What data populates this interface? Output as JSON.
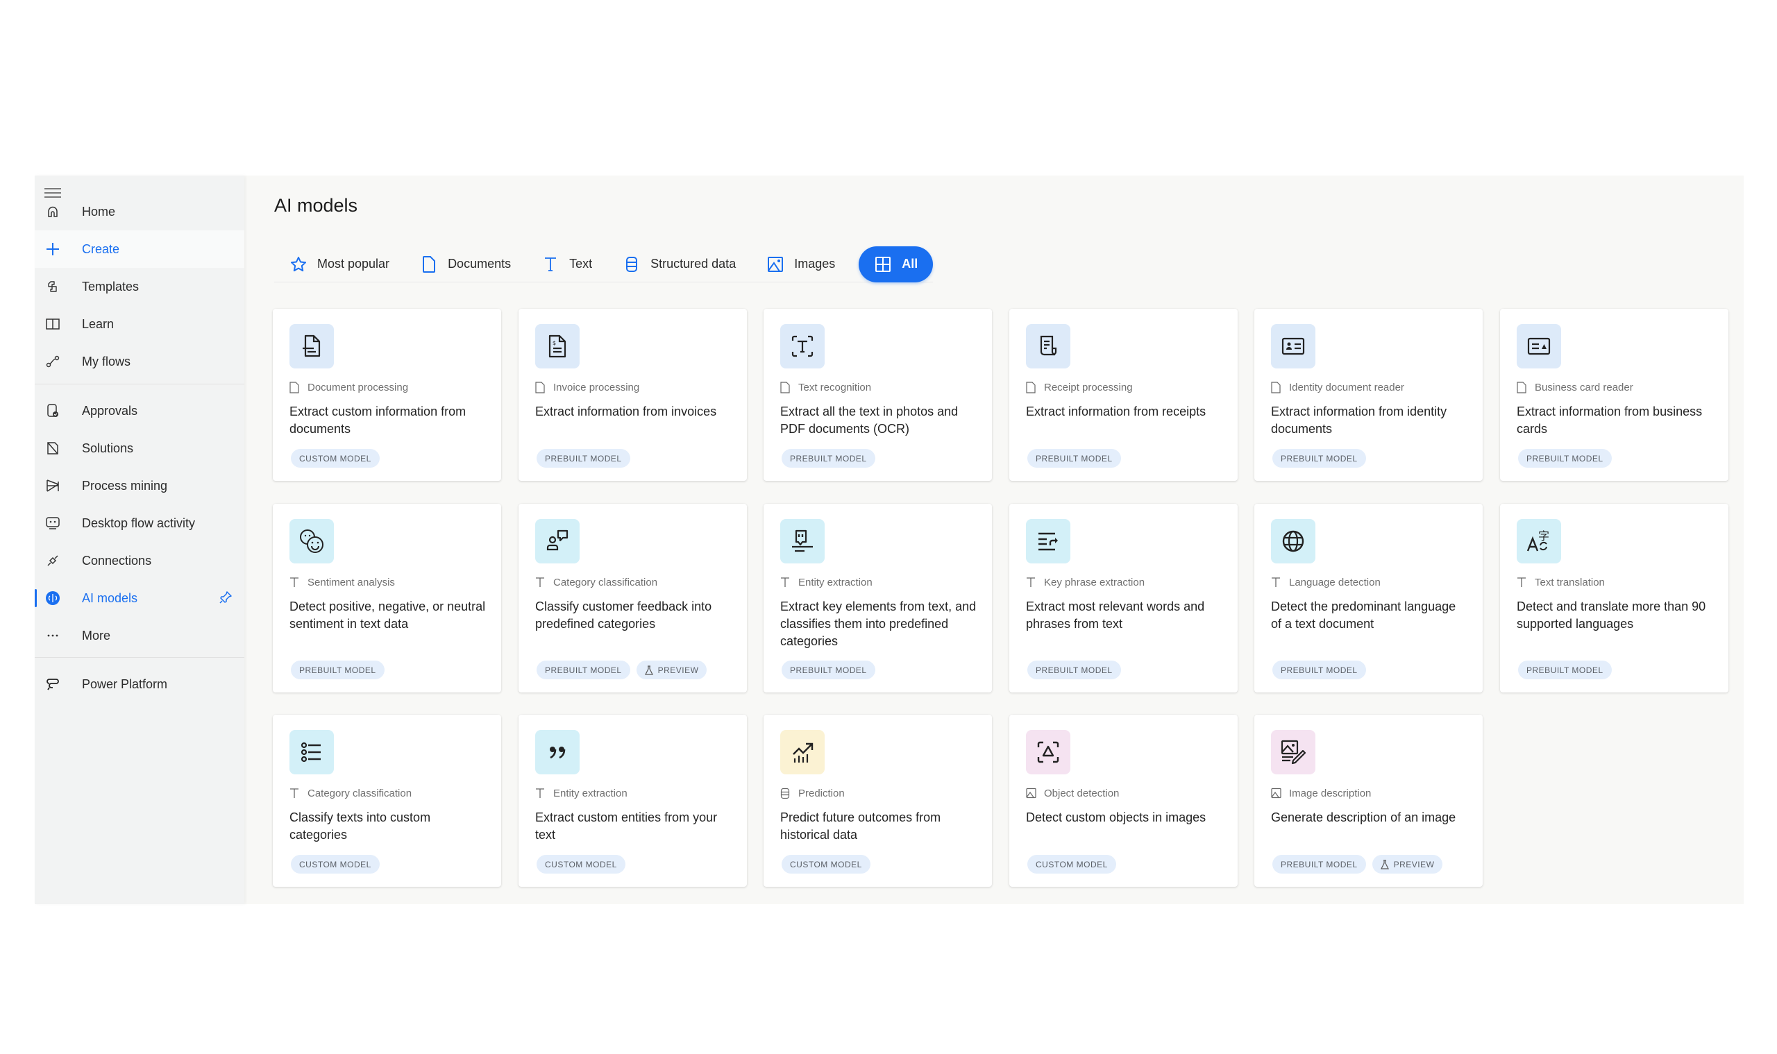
{
  "sidebar": {
    "menu_icon": "hamburger-icon",
    "items": [
      {
        "label": "Home",
        "icon": "home-icon"
      },
      {
        "label": "Create",
        "icon": "plus-icon"
      },
      {
        "label": "Templates",
        "icon": "templates-icon"
      },
      {
        "label": "Learn",
        "icon": "book-icon"
      },
      {
        "label": "My flows",
        "icon": "flows-icon"
      },
      {
        "label": "Approvals",
        "icon": "approvals-icon"
      },
      {
        "label": "Solutions",
        "icon": "solutions-icon"
      },
      {
        "label": "Process mining",
        "icon": "process-mining-icon"
      },
      {
        "label": "Desktop flow activity",
        "icon": "desktop-flow-icon"
      },
      {
        "label": "Connections",
        "icon": "connections-icon"
      },
      {
        "label": "AI models",
        "icon": "ai-brain-icon",
        "active": true,
        "pinned": true
      },
      {
        "label": "More",
        "icon": "ellipsis-icon"
      },
      {
        "label": "Power Platform",
        "icon": "power-platform-icon"
      }
    ]
  },
  "page": {
    "title": "AI models"
  },
  "tabs": [
    {
      "label": "Most popular",
      "icon": "star-icon"
    },
    {
      "label": "Documents",
      "icon": "document-icon"
    },
    {
      "label": "Text",
      "icon": "text-icon"
    },
    {
      "label": "Structured data",
      "icon": "database-icon"
    },
    {
      "label": "Images",
      "icon": "image-icon"
    },
    {
      "label": "All",
      "icon": "grid-icon",
      "selected": true
    }
  ],
  "colors": {
    "accent": "#1a6ff0",
    "tile_blue": "#ddeaf9",
    "tile_cyan": "#d3f0f8",
    "tile_yellow": "#fbf2d3",
    "tile_pink": "#f5e3f1",
    "badge_bg": "#e4eefb"
  },
  "cards": [
    {
      "category": "Document processing",
      "category_icon": "document-icon",
      "description": "Extract custom information from documents",
      "icon": "document-extract-icon",
      "badges": [
        "CUSTOM MODEL"
      ]
    },
    {
      "category": "Invoice processing",
      "category_icon": "document-icon",
      "description": "Extract information from invoices",
      "icon": "invoice-icon",
      "badges": [
        "PREBUILT MODEL"
      ]
    },
    {
      "category": "Text recognition",
      "category_icon": "document-icon",
      "description": "Extract all the text in photos and PDF documents (OCR)",
      "icon": "text-scan-icon",
      "badges": [
        "PREBUILT MODEL"
      ]
    },
    {
      "category": "Receipt processing",
      "category_icon": "document-icon",
      "description": "Extract information from receipts",
      "icon": "receipt-icon",
      "badges": [
        "PREBUILT MODEL"
      ]
    },
    {
      "category": "Identity document reader",
      "category_icon": "document-icon",
      "description": "Extract information from identity documents",
      "icon": "id-card-icon",
      "badges": [
        "PREBUILT MODEL"
      ]
    },
    {
      "category": "Business card reader",
      "category_icon": "document-icon",
      "description": "Extract information from business cards",
      "icon": "business-card-icon",
      "badges": [
        "PREBUILT MODEL"
      ]
    },
    {
      "category": "Sentiment analysis",
      "category_icon": "text-icon",
      "description": "Detect positive, negative, or neutral sentiment in text data",
      "icon": "sentiment-icon",
      "badges": [
        "PREBUILT MODEL"
      ]
    },
    {
      "category": "Category classification",
      "category_icon": "text-icon",
      "description": "Classify customer feedback into predefined categories",
      "icon": "person-feedback-icon",
      "badges": [
        "PREBUILT MODEL",
        "PREVIEW"
      ]
    },
    {
      "category": "Entity extraction",
      "category_icon": "text-icon",
      "description": "Extract key elements from text, and classifies them into predefined categories",
      "icon": "entity-quote-icon",
      "badges": [
        "PREBUILT MODEL"
      ]
    },
    {
      "category": "Key phrase extraction",
      "category_icon": "text-icon",
      "description": "Extract most relevant words and phrases from text",
      "icon": "key-phrase-icon",
      "badges": [
        "PREBUILT MODEL"
      ]
    },
    {
      "category": "Language detection",
      "category_icon": "text-icon",
      "description": "Detect the predominant language of a text document",
      "icon": "globe-icon",
      "badges": [
        "PREBUILT MODEL"
      ]
    },
    {
      "category": "Text translation",
      "category_icon": "text-icon",
      "description": "Detect and translate more than 90 supported languages",
      "icon": "translate-icon",
      "badges": [
        "PREBUILT MODEL"
      ]
    },
    {
      "category": "Category classification",
      "category_icon": "text-icon",
      "description": "Classify texts into custom categories",
      "icon": "list-icon",
      "badges": [
        "CUSTOM MODEL"
      ]
    },
    {
      "category": "Entity extraction",
      "category_icon": "text-icon",
      "description": "Extract custom entities from your text",
      "icon": "quote-icon",
      "badges": [
        "CUSTOM MODEL"
      ]
    },
    {
      "category": "Prediction",
      "category_icon": "database-icon",
      "description": "Predict future outcomes from historical data",
      "icon": "trend-chart-icon",
      "badges": [
        "CUSTOM MODEL"
      ]
    },
    {
      "category": "Object detection",
      "category_icon": "image-icon",
      "description": "Detect custom objects in images",
      "icon": "object-detect-icon",
      "badges": [
        "CUSTOM MODEL"
      ]
    },
    {
      "category": "Image description",
      "category_icon": "image-icon",
      "description": "Generate description of an image",
      "icon": "image-describe-icon",
      "badges": [
        "PREBUILT MODEL",
        "PREVIEW"
      ]
    }
  ]
}
